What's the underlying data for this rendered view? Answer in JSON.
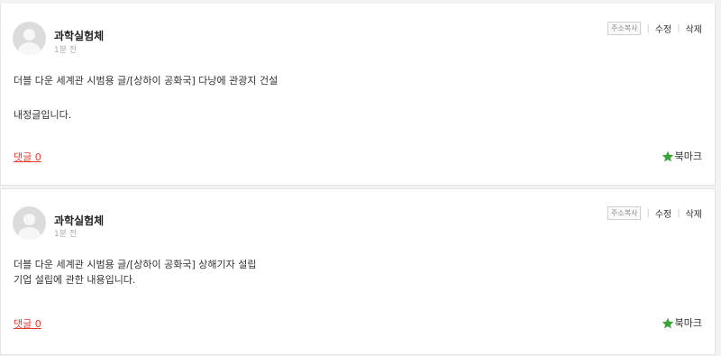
{
  "posts": [
    {
      "author": "과학실험체",
      "time": "1분 전",
      "actions": {
        "copy_address": "주소복사",
        "edit": "수정",
        "delete": "삭제"
      },
      "content": [
        "더블 다운 세계관 시범용 글/[상하이 공화국] 다낭에 관광지 건설",
        "내정글입니다."
      ],
      "comments": "댓글 0",
      "bookmark": "북마크"
    },
    {
      "author": "과학실험체",
      "time": "1분 전",
      "actions": {
        "copy_address": "주소복사",
        "edit": "수정",
        "delete": "삭제"
      },
      "content": [
        "더블 다운 세계관 시범용 글/[상하이 공화국] 상해기자 설립",
        "기업 설립에 관한 내용입니다."
      ],
      "comments": "댓글 0",
      "bookmark": "북마크"
    }
  ],
  "colors": {
    "comment_link": "#e8382e",
    "bookmark_star": "#3aa335",
    "avatar_bg": "#dcdcdc"
  },
  "icons": {
    "avatar": "default-user-avatar",
    "bookmark": "star-icon"
  }
}
